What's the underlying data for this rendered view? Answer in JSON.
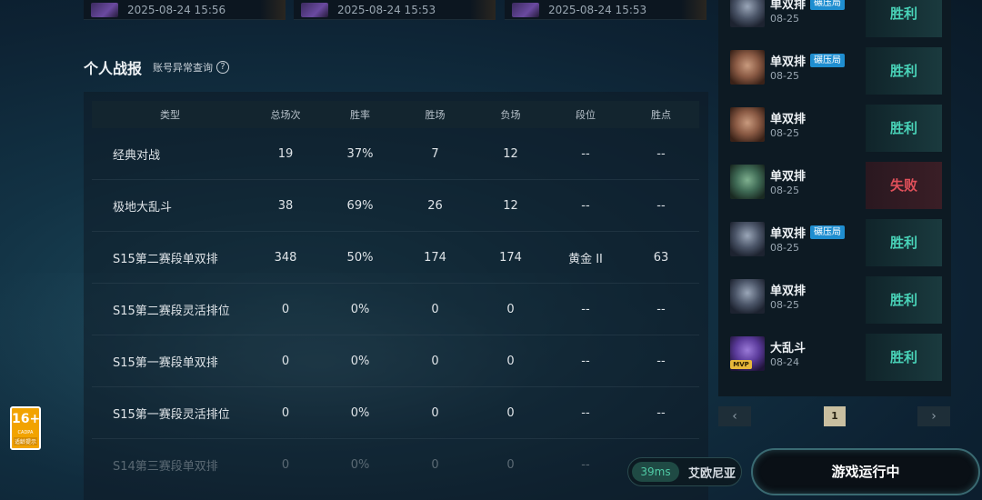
{
  "top_cards": [
    {
      "time": "2025-08-24 15:56"
    },
    {
      "time": "2025-08-24 15:53"
    },
    {
      "time": "2025-08-24 15:53"
    }
  ],
  "section": {
    "title": "个人战报",
    "account_check": "账号异常查询",
    "help_icon": "?"
  },
  "stats": {
    "headers": [
      "类型",
      "总场次",
      "胜率",
      "胜场",
      "负场",
      "段位",
      "胜点"
    ],
    "rows": [
      {
        "type": "经典对战",
        "total": "19",
        "rate": "37%",
        "win": "7",
        "loss": "12",
        "rank": "--",
        "points": "--"
      },
      {
        "type": "极地大乱斗",
        "total": "38",
        "rate": "69%",
        "win": "26",
        "loss": "12",
        "rank": "--",
        "points": "--"
      },
      {
        "type": "S15第二赛段单双排",
        "total": "348",
        "rate": "50%",
        "win": "174",
        "loss": "174",
        "rank": "黄金 II",
        "points": "63"
      },
      {
        "type": "S15第二赛段灵活排位",
        "total": "0",
        "rate": "0%",
        "win": "0",
        "loss": "0",
        "rank": "--",
        "points": "--"
      },
      {
        "type": "S15第一赛段单双排",
        "total": "0",
        "rate": "0%",
        "win": "0",
        "loss": "0",
        "rank": "--",
        "points": "--"
      },
      {
        "type": "S15第一赛段灵活排位",
        "total": "0",
        "rate": "0%",
        "win": "0",
        "loss": "0",
        "rank": "--",
        "points": "--"
      },
      {
        "type": "S14第三赛段单双排",
        "total": "0",
        "rate": "0%",
        "win": "0",
        "loss": "0",
        "rank": "--",
        "points": "--"
      }
    ]
  },
  "matches": [
    {
      "mode": "单双排",
      "date": "08-25",
      "tag": "碾压局",
      "result": "胜利",
      "outcome": "win",
      "avatar": "armor"
    },
    {
      "mode": "单双排",
      "date": "08-25",
      "tag": "碾压局",
      "result": "胜利",
      "outcome": "win",
      "avatar": "face"
    },
    {
      "mode": "单双排",
      "date": "08-25",
      "tag": "",
      "result": "胜利",
      "outcome": "win",
      "avatar": "face"
    },
    {
      "mode": "单双排",
      "date": "08-25",
      "tag": "",
      "result": "失败",
      "outcome": "lose",
      "avatar": "green"
    },
    {
      "mode": "单双排",
      "date": "08-25",
      "tag": "碾压局",
      "result": "胜利",
      "outcome": "win",
      "avatar": "armor"
    },
    {
      "mode": "单双排",
      "date": "08-25",
      "tag": "",
      "result": "胜利",
      "outcome": "win",
      "avatar": "armor"
    },
    {
      "mode": "大乱斗",
      "date": "08-24",
      "tag": "",
      "result": "胜利",
      "outcome": "win",
      "avatar": "purple",
      "mvp": "MVP"
    }
  ],
  "pagination": {
    "prev": "‹",
    "current": "1",
    "next": "›"
  },
  "age_badge": {
    "number": "16+",
    "sub": "CADPA",
    "label": "适龄提示"
  },
  "server": {
    "ping": "39ms",
    "name": "艾欧尼亚"
  },
  "run_button": {
    "label": "游戏运行中"
  },
  "colors": {
    "win": "#49d3b8",
    "lose": "#e0505a",
    "tag": "#1f8ed0",
    "mvp": "#e6b83a"
  }
}
